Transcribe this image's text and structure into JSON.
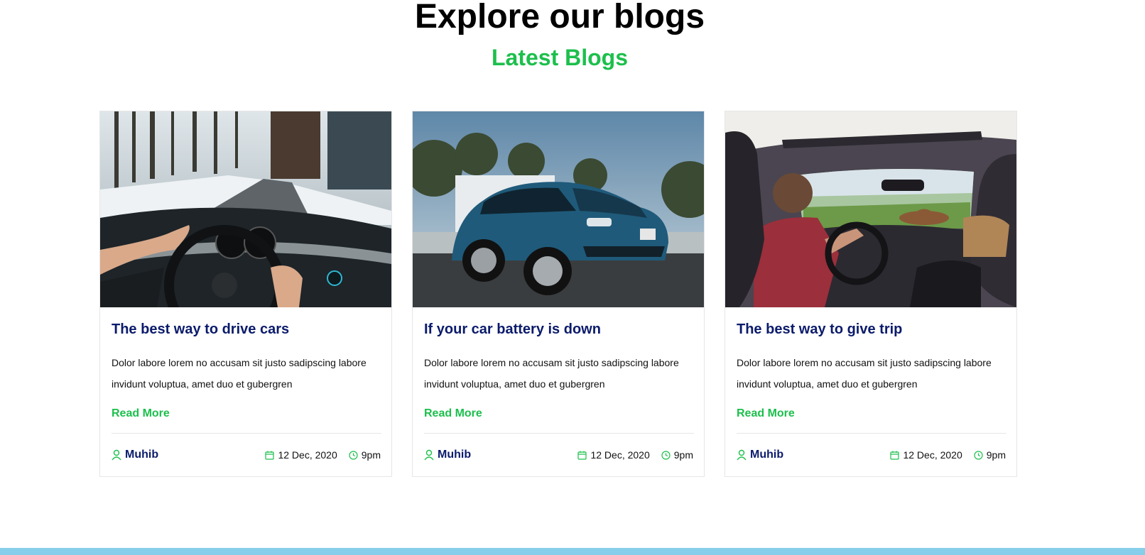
{
  "section": {
    "title": "Explore our blogs",
    "subtitle": "Latest Blogs"
  },
  "colors": {
    "accent": "#1cbf4c",
    "title_navy": "#0b1b6b",
    "footer": "#87ceea"
  },
  "cards": [
    {
      "image_icon": "car-dashboard-photo",
      "title": "The best way to drive cars",
      "text": "Dolor labore lorem no accusam sit justo sadipscing labore invidunt voluptua, amet duo et gubergren",
      "link": "Read More",
      "author": "Muhib",
      "date": "12 Dec, 2020",
      "time": "9pm"
    },
    {
      "image_icon": "blue-car-photo",
      "title": "If your car battery is down",
      "text": "Dolor labore lorem no accusam sit justo sadipscing labore invidunt voluptua, amet duo et gubergren",
      "link": "Read More",
      "author": "Muhib",
      "date": "12 Dec, 2020",
      "time": "9pm"
    },
    {
      "image_icon": "road-trip-photo",
      "title": "The best way to give trip",
      "text": "Dolor labore lorem no accusam sit justo sadipscing labore invidunt voluptua, amet duo et gubergren",
      "link": "Read More",
      "author": "Muhib",
      "date": "12 Dec, 2020",
      "time": "9pm"
    }
  ]
}
